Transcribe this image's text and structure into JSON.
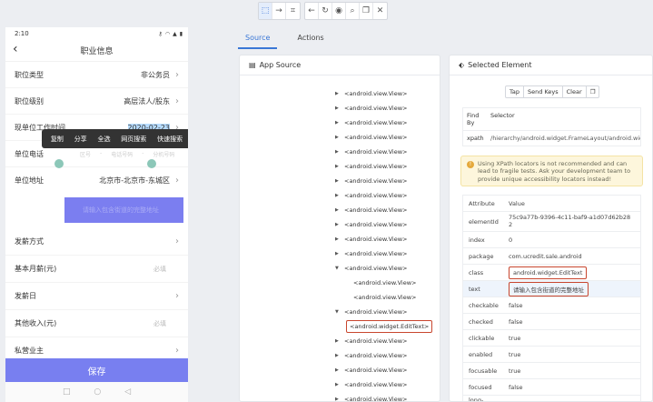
{
  "toolbar": {
    "left_group": [
      "select-icon",
      "swipe-icon",
      "tap-by-coordinates-icon"
    ],
    "right_group": [
      "back-icon",
      "refresh-icon",
      "eye-icon",
      "search-icon",
      "copy-icon",
      "close-icon"
    ]
  },
  "phone": {
    "status_time": "2:10",
    "nav_title": "职业信息",
    "rows": [
      {
        "label": "职位类型",
        "value": "非公务员"
      },
      {
        "label": "职位级别",
        "value": "高层法人/股东"
      },
      {
        "label": "现单位工作时间",
        "value": "2020-02-23"
      },
      {
        "label": "单位电话",
        "sub": [
          "区号",
          "电话号码",
          "分机号码"
        ]
      },
      {
        "label": "单位地址",
        "value": "北京市-北京市-东城区"
      }
    ],
    "address_placeholder": "请输入包含街道的完整地址",
    "rows2": [
      {
        "label": "发薪方式"
      },
      {
        "label": "基本月薪(元)",
        "placeholder": "必填"
      },
      {
        "label": "发薪日"
      },
      {
        "label": "其他收入(元)",
        "placeholder": "必填"
      },
      {
        "label": "私营业主"
      }
    ],
    "context_menu": [
      "复制",
      "分享",
      "全选",
      "网页搜索",
      "快速搜索"
    ],
    "save_label": "保存"
  },
  "tabs": [
    "Source",
    "Actions"
  ],
  "source_panel": {
    "title": "App Source",
    "nodes": [
      {
        "indent": 105,
        "label": "<android.view.View>",
        "expanded": false
      },
      {
        "indent": 105,
        "label": "<android.view.View>",
        "expanded": false
      },
      {
        "indent": 105,
        "label": "<android.view.View>",
        "expanded": false
      },
      {
        "indent": 105,
        "label": "<android.view.View>",
        "expanded": false
      },
      {
        "indent": 105,
        "label": "<android.view.View>",
        "expanded": false
      },
      {
        "indent": 105,
        "label": "<android.view.View>",
        "expanded": false
      },
      {
        "indent": 105,
        "label": "<android.view.View>",
        "expanded": false
      },
      {
        "indent": 105,
        "label": "<android.view.View>",
        "expanded": false
      },
      {
        "indent": 105,
        "label": "<android.view.View>",
        "expanded": false
      },
      {
        "indent": 105,
        "label": "<android.view.View>",
        "expanded": false
      },
      {
        "indent": 105,
        "label": "<android.view.View>",
        "expanded": false
      },
      {
        "indent": 105,
        "label": "<android.view.View>",
        "expanded": false
      },
      {
        "indent": 105,
        "label": "<android.view.View>",
        "expanded": true
      },
      {
        "indent": 125,
        "label": "<android.view.View>",
        "leaf": true
      },
      {
        "indent": 125,
        "label": "<android.view.View>",
        "leaf": true
      },
      {
        "indent": 105,
        "label": "<android.view.View>",
        "expanded": true
      },
      {
        "indent": 117,
        "label": "<android.widget.EditText>",
        "leaf": true,
        "boxed": true
      },
      {
        "indent": 105,
        "label": "<android.view.View>",
        "expanded": false
      },
      {
        "indent": 105,
        "label": "<android.view.View>",
        "expanded": false
      },
      {
        "indent": 105,
        "label": "<android.view.View>",
        "expanded": false
      },
      {
        "indent": 105,
        "label": "<android.view.View>",
        "expanded": false
      },
      {
        "indent": 105,
        "label": "<android.view.View>",
        "expanded": false
      },
      {
        "indent": 105,
        "label": "<android.view.View>",
        "expanded": false
      }
    ]
  },
  "selected_panel": {
    "title": "Selected Element",
    "actions": [
      "Tap",
      "Send Keys",
      "Clear"
    ],
    "find_by_header": [
      "Find By",
      "Selector"
    ],
    "find_by_row": [
      "xpath",
      "/hierarchy/android.widget.FrameLayout/android.widget.Line"
    ],
    "warning": "Using XPath locators is not recommended and can lead to fragile tests. Ask your development team to provide unique accessibility locators instead!",
    "attr_header": [
      "Attribute",
      "Value"
    ],
    "attributes": [
      {
        "k": "elementId",
        "v": "75c9a77b-9396-4c11-baf9-a1d07d62b282",
        "tall": true
      },
      {
        "k": "index",
        "v": "0"
      },
      {
        "k": "package",
        "v": "com.ucredit.sale.android"
      },
      {
        "k": "class",
        "v": "android.widget.EditText",
        "boxed": true
      },
      {
        "k": "text",
        "v": "请输入包含街道的完整地址",
        "boxed": true,
        "hl": true
      },
      {
        "k": "checkable",
        "v": "false"
      },
      {
        "k": "checked",
        "v": "false"
      },
      {
        "k": "clickable",
        "v": "true"
      },
      {
        "k": "enabled",
        "v": "true"
      },
      {
        "k": "focusable",
        "v": "true"
      },
      {
        "k": "focused",
        "v": "false"
      },
      {
        "k": "long-clickable",
        "v": "false"
      }
    ]
  }
}
